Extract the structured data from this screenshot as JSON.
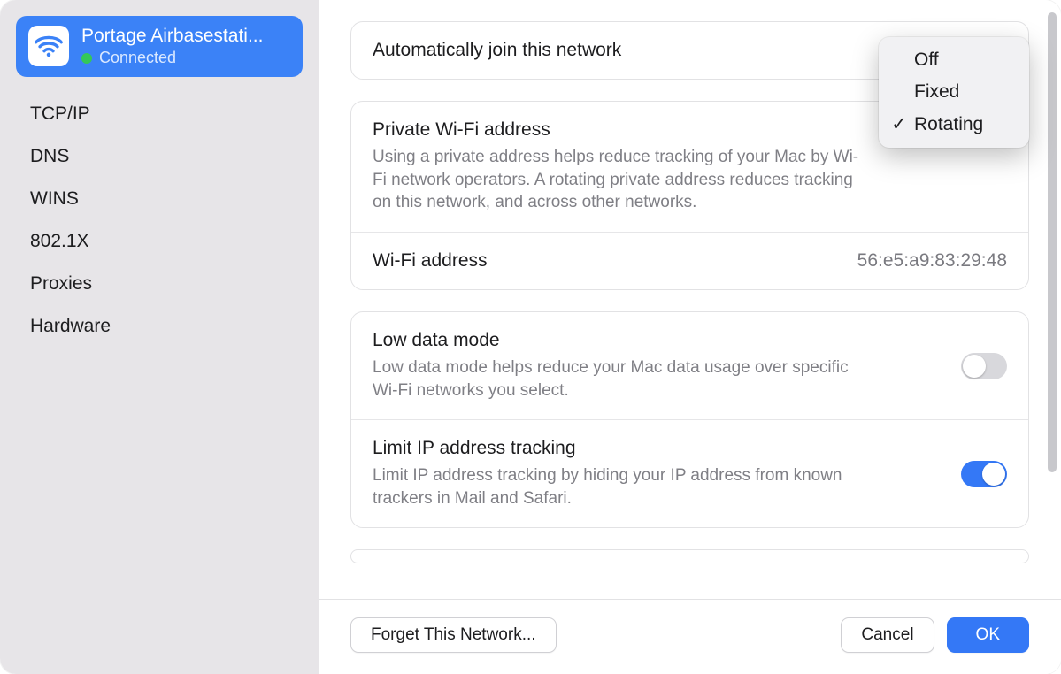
{
  "sidebar": {
    "network_name": "Portage Airbasestati...",
    "status_label": "Connected",
    "items": [
      {
        "label": "TCP/IP"
      },
      {
        "label": "DNS"
      },
      {
        "label": "WINS"
      },
      {
        "label": "802.1X"
      },
      {
        "label": "Proxies"
      },
      {
        "label": "Hardware"
      }
    ]
  },
  "main": {
    "auto_join": {
      "title": "Automatically join this network"
    },
    "private_addr": {
      "title": "Private Wi-Fi address",
      "desc": "Using a private address helps reduce tracking of your Mac by Wi-Fi network operators. A rotating private address reduces tracking on this network, and across other networks."
    },
    "wifi_addr": {
      "title": "Wi-Fi address",
      "value": "56:e5:a9:83:29:48"
    },
    "low_data": {
      "title": "Low data mode",
      "desc": "Low data mode helps reduce your Mac data usage over specific Wi-Fi networks you select.",
      "enabled": false
    },
    "limit_ip": {
      "title": "Limit IP address tracking",
      "desc": "Limit IP address tracking by hiding your IP address from known trackers in Mail and Safari.",
      "enabled": true
    }
  },
  "dropdown": {
    "options": [
      {
        "label": "Off",
        "selected": false
      },
      {
        "label": "Fixed",
        "selected": false
      },
      {
        "label": "Rotating",
        "selected": true
      }
    ]
  },
  "footer": {
    "forget": "Forget This Network...",
    "cancel": "Cancel",
    "ok": "OK"
  }
}
